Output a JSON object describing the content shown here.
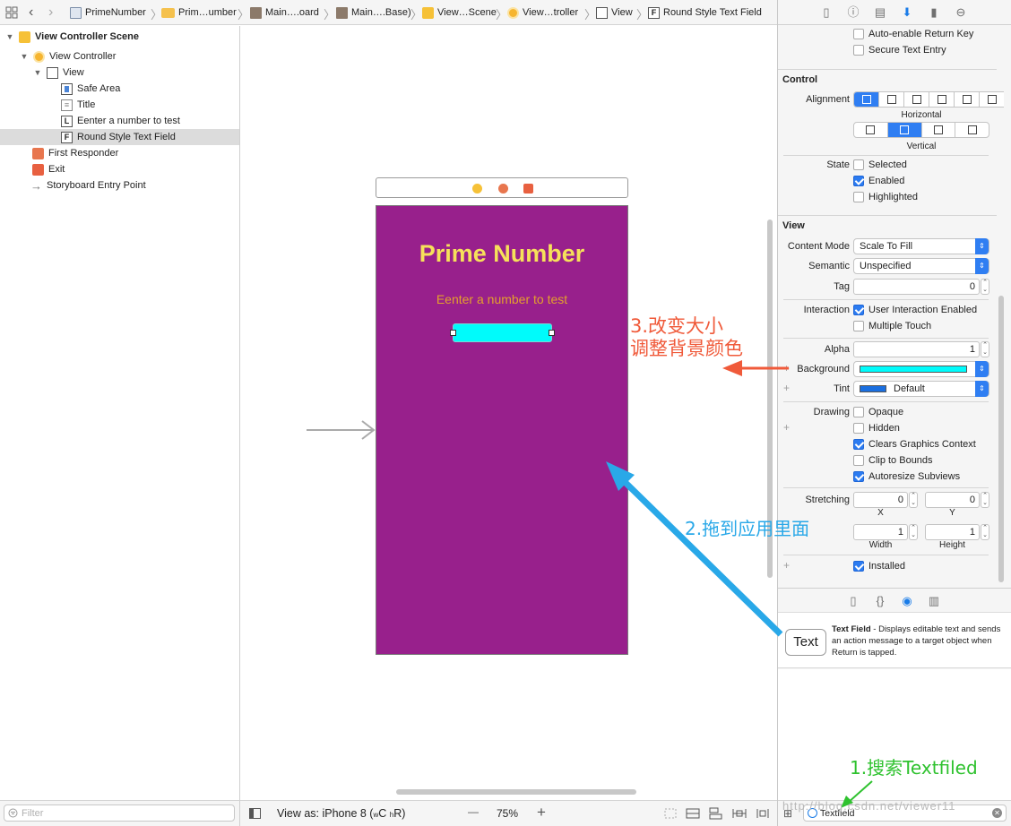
{
  "breadcrumb": [
    {
      "icon": "project-file-icon",
      "label": "PrimeNumber"
    },
    {
      "icon": "folder-icon",
      "label": "Prim…umber"
    },
    {
      "icon": "storyboard-icon",
      "label": "Main….oard"
    },
    {
      "icon": "storyboard-icon",
      "label": "Main….Base)"
    },
    {
      "icon": "scene-icon",
      "label": "View…Scene"
    },
    {
      "icon": "view-controller-icon",
      "label": "View…troller"
    },
    {
      "icon": "view-icon",
      "label": "View"
    },
    {
      "icon": "text-field-icon",
      "label": "Round Style Text Field"
    }
  ],
  "navigator": {
    "scene": "View Controller Scene",
    "view_controller": "View Controller",
    "view": "View",
    "children": [
      "Safe Area",
      "Title",
      "Eenter a number to test",
      "Round Style Text Field"
    ],
    "others": [
      "First Responder",
      "Exit",
      "Storyboard Entry Point"
    ],
    "filter_placeholder": "Filter"
  },
  "canvas": {
    "app_title": "Prime Number",
    "subtitle": "Eenter a number to test",
    "colors": {
      "background": "#98208c",
      "title": "#f6e15a",
      "subtitle": "#e4a02c",
      "field": "#00fbfb"
    }
  },
  "bottom_bar": {
    "view_as_prefix": "View as: iPhone 8 (",
    "size_w": "w",
    "size_c": "C ",
    "size_h": "h",
    "size_r": "R)",
    "zoom": "75%",
    "minus": "—",
    "plus": "+"
  },
  "inspector": {
    "top_checkboxes": [
      {
        "label": "Auto-enable Return Key",
        "checked": false
      },
      {
        "label": "Secure Text Entry",
        "checked": false
      }
    ],
    "control": {
      "title": "Control",
      "alignment_label": "Alignment",
      "horizontal_label": "Horizontal",
      "vertical_label": "Vertical",
      "state_label": "State",
      "states": [
        {
          "label": "Selected",
          "checked": false
        },
        {
          "label": "Enabled",
          "checked": true
        },
        {
          "label": "Highlighted",
          "checked": false
        }
      ]
    },
    "view": {
      "title": "View",
      "content_mode_label": "Content Mode",
      "content_mode": "Scale To Fill",
      "semantic_label": "Semantic",
      "semantic": "Unspecified",
      "tag_label": "Tag",
      "tag": "0",
      "interaction_label": "Interaction",
      "interaction": [
        {
          "label": "User Interaction Enabled",
          "checked": true
        },
        {
          "label": "Multiple Touch",
          "checked": false
        }
      ],
      "alpha_label": "Alpha",
      "alpha": "1",
      "background_label": "Background",
      "background_color": "#00fbfb",
      "tint_label": "Tint",
      "tint": "Default",
      "tint_color": "#1a6fe0",
      "drawing_label": "Drawing",
      "drawing": [
        {
          "label": "Opaque",
          "checked": false
        },
        {
          "label": "Hidden",
          "checked": false
        },
        {
          "label": "Clears Graphics Context",
          "checked": true
        },
        {
          "label": "Clip to Bounds",
          "checked": false
        },
        {
          "label": "Autoresize Subviews",
          "checked": true
        }
      ],
      "stretching_label": "Stretching",
      "stretch_x": "0",
      "stretch_y": "0",
      "stretch_w": "1",
      "stretch_h": "1",
      "x_label": "X",
      "y_label": "Y",
      "width_label": "Width",
      "height_label": "Height",
      "installed_label": "Installed",
      "installed": true
    },
    "library": {
      "badge": "Text",
      "name": "Text Field",
      "description": " - Displays editable text and sends an action message to a target object when Return is tapped.",
      "search_value": "Textfield"
    }
  },
  "annotations": {
    "step1": "1.搜索Textfiled",
    "step2": "2.拖到应用里面",
    "step3_line1": "3.改变大小",
    "step3_line2": "调整背景颜色",
    "colors": {
      "step1": "#2fc22f",
      "step2": "#29a8e8",
      "step3": "#f05a3a"
    }
  },
  "watermark": "http://blog.csdn.net/viewer11"
}
